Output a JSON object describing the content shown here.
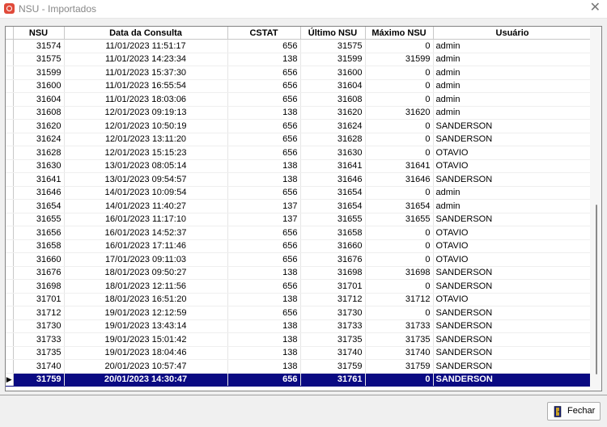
{
  "window": {
    "title": "NSU - Importados",
    "close_glyph": "✕"
  },
  "columns": [
    "NSU",
    "Data da Consulta",
    "CSTAT",
    "Último NSU",
    "Máximo NSU",
    "Usuário"
  ],
  "rows": [
    [
      "31574",
      "11/01/2023 11:51:17",
      "656",
      "31575",
      "0",
      "admin"
    ],
    [
      "31575",
      "11/01/2023 14:23:34",
      "138",
      "31599",
      "31599",
      "admin"
    ],
    [
      "31599",
      "11/01/2023 15:37:30",
      "656",
      "31600",
      "0",
      "admin"
    ],
    [
      "31600",
      "11/01/2023 16:55:54",
      "656",
      "31604",
      "0",
      "admin"
    ],
    [
      "31604",
      "11/01/2023 18:03:06",
      "656",
      "31608",
      "0",
      "admin"
    ],
    [
      "31608",
      "12/01/2023 09:19:13",
      "138",
      "31620",
      "31620",
      "admin"
    ],
    [
      "31620",
      "12/01/2023 10:50:19",
      "656",
      "31624",
      "0",
      "SANDERSON"
    ],
    [
      "31624",
      "12/01/2023 13:11:20",
      "656",
      "31628",
      "0",
      "SANDERSON"
    ],
    [
      "31628",
      "12/01/2023 15:15:23",
      "656",
      "31630",
      "0",
      "OTAVIO"
    ],
    [
      "31630",
      "13/01/2023 08:05:14",
      "138",
      "31641",
      "31641",
      "OTAVIO"
    ],
    [
      "31641",
      "13/01/2023 09:54:57",
      "138",
      "31646",
      "31646",
      "SANDERSON"
    ],
    [
      "31646",
      "14/01/2023 10:09:54",
      "656",
      "31654",
      "0",
      "admin"
    ],
    [
      "31654",
      "14/01/2023 11:40:27",
      "137",
      "31654",
      "31654",
      "admin"
    ],
    [
      "31655",
      "16/01/2023 11:17:10",
      "137",
      "31655",
      "31655",
      "SANDERSON"
    ],
    [
      "31656",
      "16/01/2023 14:52:37",
      "656",
      "31658",
      "0",
      "OTAVIO"
    ],
    [
      "31658",
      "16/01/2023 17:11:46",
      "656",
      "31660",
      "0",
      "OTAVIO"
    ],
    [
      "31660",
      "17/01/2023 09:11:03",
      "656",
      "31676",
      "0",
      "OTAVIO"
    ],
    [
      "31676",
      "18/01/2023 09:50:27",
      "138",
      "31698",
      "31698",
      "SANDERSON"
    ],
    [
      "31698",
      "18/01/2023 12:11:56",
      "656",
      "31701",
      "0",
      "SANDERSON"
    ],
    [
      "31701",
      "18/01/2023 16:51:20",
      "138",
      "31712",
      "31712",
      "OTAVIO"
    ],
    [
      "31712",
      "19/01/2023 12:12:59",
      "656",
      "31730",
      "0",
      "SANDERSON"
    ],
    [
      "31730",
      "19/01/2023 13:43:14",
      "138",
      "31733",
      "31733",
      "SANDERSON"
    ],
    [
      "31733",
      "19/01/2023 15:01:42",
      "138",
      "31735",
      "31735",
      "SANDERSON"
    ],
    [
      "31735",
      "19/01/2023 18:04:46",
      "138",
      "31740",
      "31740",
      "SANDERSON"
    ],
    [
      "31740",
      "20/01/2023 10:57:47",
      "138",
      "31759",
      "31759",
      "SANDERSON"
    ],
    [
      "31759",
      "20/01/2023 14:30:47",
      "656",
      "31761",
      "0",
      "SANDERSON"
    ]
  ],
  "selected_row": 25,
  "row_indicator_glyph": "▶",
  "buttons": {
    "fechar": "Fechar"
  },
  "colors": {
    "selection": "#0a0a82",
    "app_icon": "#e04a3a"
  },
  "icons": {
    "app": "app-logo-icon",
    "fechar": "door-exit-icon",
    "close": "close-icon"
  }
}
